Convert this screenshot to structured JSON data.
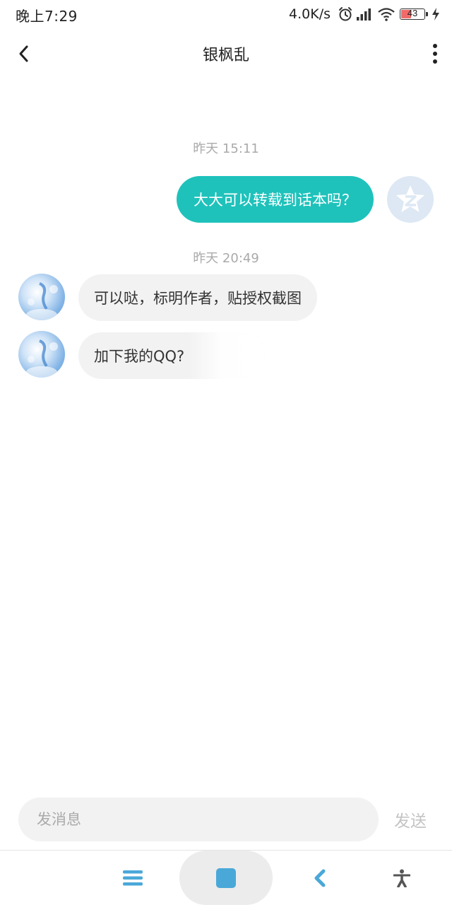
{
  "status_bar": {
    "time": "晚上7:29",
    "net_speed": "4.0K/s",
    "battery_level": "43",
    "icons": [
      "alarm-icon",
      "signal-icon",
      "wifi-icon",
      "battery-icon",
      "charging-icon"
    ]
  },
  "header": {
    "title": "银枫乱",
    "back_icon": "chevron-left-icon",
    "more_icon": "more-vertical-icon"
  },
  "messages": [
    {
      "type": "timestamp",
      "text": "昨天 15:11"
    },
    {
      "type": "outgoing",
      "text": "大大可以转载到话本吗？"
    },
    {
      "type": "timestamp",
      "text": "昨天 20:49"
    },
    {
      "type": "incoming",
      "text": "可以哒，标明作者，贴授权截图"
    },
    {
      "type": "incoming",
      "text": "加下我的QQ?"
    }
  ],
  "input": {
    "placeholder": "发消息",
    "send_label": "发送"
  },
  "bottom_nav": {
    "items": [
      "menu-icon",
      "home-icon",
      "back-icon",
      "accessibility-icon"
    ]
  },
  "colors": {
    "accent": "#1ec2bb",
    "incoming_bubble": "#f2f2f2",
    "timestamp": "#aaaaaa",
    "nav_icon": "#4aa8d8"
  }
}
